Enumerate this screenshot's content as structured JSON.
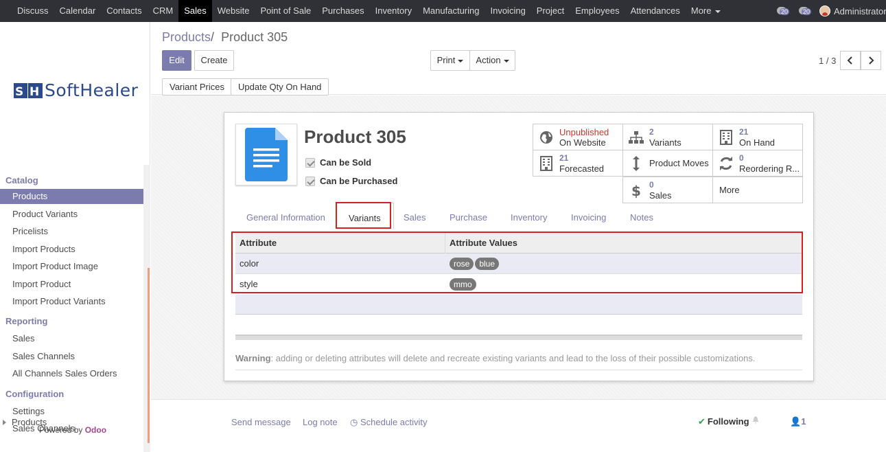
{
  "topbar": {
    "menu": [
      "Discuss",
      "Calendar",
      "Contacts",
      "CRM",
      "Sales",
      "Website",
      "Point of Sale",
      "Purchases",
      "Inventory",
      "Manufacturing",
      "Invoicing",
      "Project",
      "Employees",
      "Attendances",
      "More"
    ],
    "active": "Sales",
    "activities_count": "20",
    "messages_count": "20",
    "user": "Administrator"
  },
  "sidebar": {
    "logo_text": "SoftHealer",
    "sections": [
      {
        "title": "Catalog",
        "items": [
          "Products",
          "Product Variants",
          "Pricelists",
          "Import Products",
          "Import Product Image",
          "Import Product",
          "Import Product Variants"
        ]
      },
      {
        "title": "Reporting",
        "items": [
          "Sales",
          "Sales Channels",
          "All Channels Sales Orders"
        ]
      },
      {
        "title": "Configuration",
        "items": [
          "Settings",
          "Sales Channels"
        ]
      }
    ],
    "active_item": "Products",
    "sub_item": "Products",
    "powered_by": "Powered by",
    "powered_brand": "Odoo"
  },
  "control_panel": {
    "breadcrumb_parent": "Products",
    "breadcrumb_sep": "/",
    "breadcrumb_current": "Product 305",
    "edit_label": "Edit",
    "create_label": "Create",
    "print_label": "Print",
    "action_label": "Action",
    "pager": "1 / 3",
    "variant_prices_label": "Variant Prices",
    "update_qty_label": "Update Qty On Hand"
  },
  "product": {
    "name": "Product 305",
    "can_be_sold": "Can be Sold",
    "can_be_purchased": "Can be Purchased",
    "stats": {
      "website": {
        "line1": "Unpublished",
        "line2": "On Website"
      },
      "variants": {
        "num": "2",
        "label": "Variants"
      },
      "on_hand": {
        "num": "21",
        "label": "On Hand"
      },
      "forecasted": {
        "num": "21",
        "label": "Forecasted"
      },
      "product_moves": {
        "label": "Product Moves"
      },
      "reordering": {
        "num": "0",
        "label": "Reordering R..."
      },
      "sales": {
        "num": "0",
        "label": "Sales"
      },
      "more": {
        "label": "More"
      }
    },
    "tabs": [
      "General Information",
      "Variants",
      "Sales",
      "Purchase",
      "Inventory",
      "Invoicing",
      "Notes"
    ],
    "active_tab": "Variants",
    "attributes": {
      "headers": [
        "Attribute",
        "Attribute Values"
      ],
      "rows": [
        {
          "attribute": "color",
          "values": [
            "rose",
            "blue"
          ]
        },
        {
          "attribute": "style",
          "values": [
            "mmo"
          ]
        }
      ]
    },
    "warning_label": "Warning",
    "warning_text": ": adding or deleting attributes will delete and recreate existing variants and lead to the loss of their possible customizations."
  },
  "chatter": {
    "send_message": "Send message",
    "log_note": "Log note",
    "schedule_activity": "Schedule activity",
    "following": "Following",
    "followers": "1"
  },
  "colors": {
    "accent": "#7c7bad",
    "topbar": "#2f3136",
    "highlight": "#d62020",
    "unpublished": "#c0392b"
  }
}
